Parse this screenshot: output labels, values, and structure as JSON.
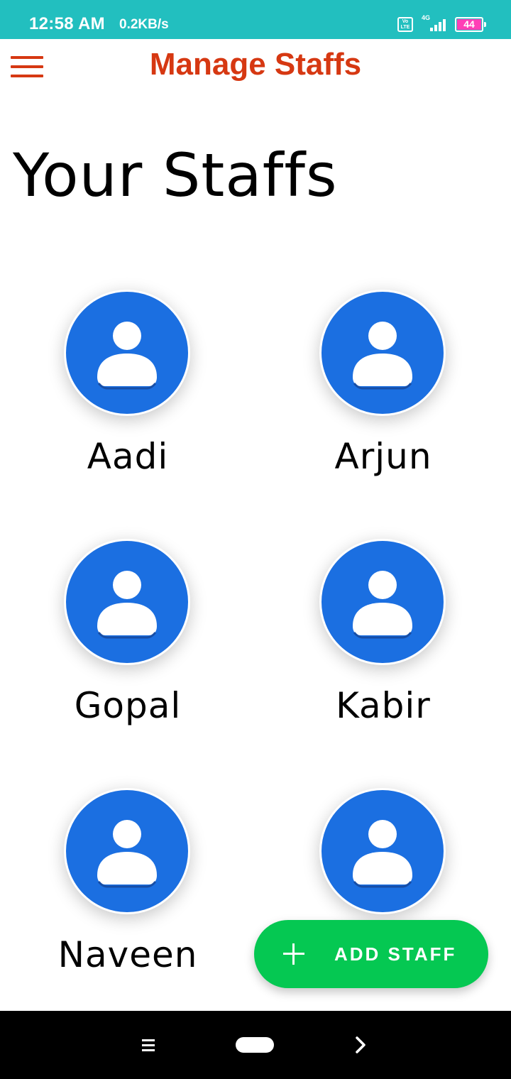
{
  "status_bar": {
    "time": "12:58 AM",
    "speed": "0.2KB/s",
    "volte_label_top": "Vo",
    "volte_label_bottom": "LTE",
    "network_label": "4G",
    "battery": "44",
    "background": "#22bfbf",
    "battery_color": "#ff3fb6"
  },
  "app_bar": {
    "title": "Manage Staffs",
    "menu_icon": "hamburger-menu-icon",
    "accent": "#d63812"
  },
  "page": {
    "heading": "Your Staffs"
  },
  "staff": [
    {
      "name": "Aadi",
      "avatar_icon": "person-icon"
    },
    {
      "name": "Arjun",
      "avatar_icon": "person-icon"
    },
    {
      "name": "Gopal",
      "avatar_icon": "person-icon"
    },
    {
      "name": "Kabir",
      "avatar_icon": "person-icon"
    },
    {
      "name": "Naveen",
      "avatar_icon": "person-icon"
    },
    {
      "name": "",
      "avatar_icon": "person-icon"
    }
  ],
  "fab": {
    "label": "ADD STAFF",
    "icon": "plus-icon",
    "color": "#05c852"
  },
  "nav_bar": {
    "recents_icon": "recents-menu-icon",
    "home_icon": "home-pill-icon",
    "back_icon": "back-chevron-icon"
  }
}
